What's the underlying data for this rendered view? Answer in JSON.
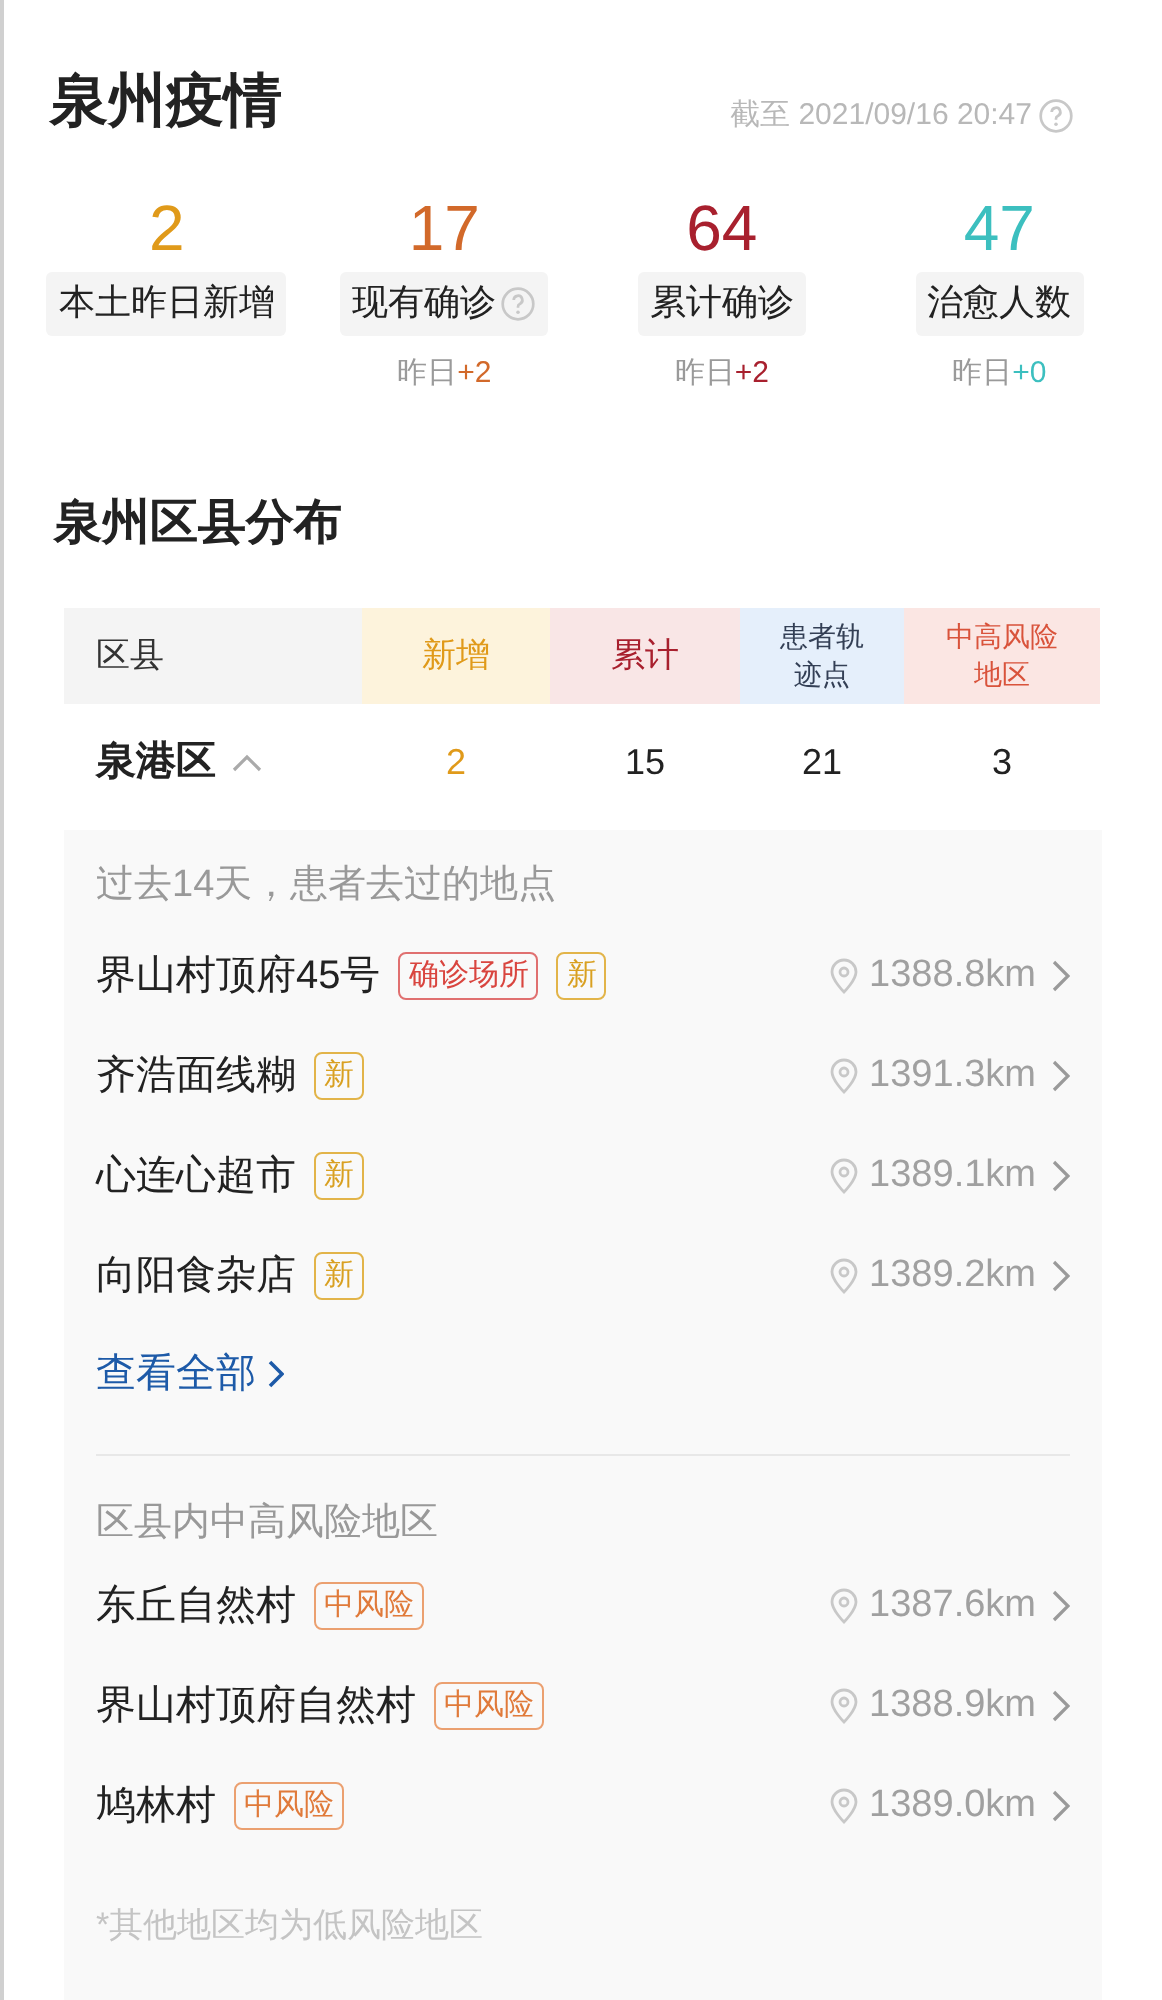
{
  "header": {
    "title": "泉州疫情",
    "timestamp": "截至 2021/09/16 20:47"
  },
  "stats": [
    {
      "value": "2",
      "label": "本土昨日新增",
      "color": "#e09a1a",
      "help": false
    },
    {
      "value": "17",
      "label": "现有确诊",
      "color": "#d2692a",
      "help": true,
      "delta_label": "昨日",
      "delta": "+2"
    },
    {
      "value": "64",
      "label": "累计确诊",
      "color": "#a8202e",
      "help": false,
      "delta_label": "昨日",
      "delta": "+2"
    },
    {
      "value": "47",
      "label": "治愈人数",
      "color": "#3cbfbf",
      "help": false,
      "delta_label": "昨日",
      "delta": "+0"
    }
  ],
  "district_section": {
    "title": "泉州区县分布"
  },
  "table": {
    "columns": [
      "区县",
      "新增",
      "累计",
      "患者轨迹点",
      "中高风险地区"
    ],
    "rows": [
      {
        "expanded": true,
        "cells": [
          "泉港区",
          "2",
          "15",
          "21",
          "3"
        ]
      }
    ]
  },
  "places": {
    "title": "过去14天，患者去过的地点",
    "items": [
      {
        "name": "界山村顶府45号",
        "tags": [
          {
            "kind": "confirmed",
            "text": "确诊场所"
          },
          {
            "kind": "new",
            "text": "新"
          }
        ],
        "distance": "1388.8km"
      },
      {
        "name": "齐浩面线糊",
        "tags": [
          {
            "kind": "new",
            "text": "新"
          }
        ],
        "distance": "1391.3km"
      },
      {
        "name": "心连心超市",
        "tags": [
          {
            "kind": "new",
            "text": "新"
          }
        ],
        "distance": "1389.1km"
      },
      {
        "name": "向阳食杂店",
        "tags": [
          {
            "kind": "new",
            "text": "新"
          }
        ],
        "distance": "1389.2km"
      }
    ],
    "view_all": "查看全部"
  },
  "risk_areas": {
    "title": "区县内中高风险地区",
    "items": [
      {
        "name": "东丘自然村",
        "tags": [
          {
            "kind": "mid-risk",
            "text": "中风险"
          }
        ],
        "distance": "1387.6km"
      },
      {
        "name": "界山村顶府自然村",
        "tags": [
          {
            "kind": "mid-risk",
            "text": "中风险"
          }
        ],
        "distance": "1388.9km"
      },
      {
        "name": "鸠林村",
        "tags": [
          {
            "kind": "mid-risk",
            "text": "中风险"
          }
        ],
        "distance": "1389.0km"
      }
    ],
    "footnote": "*其他地区均为低风险地区"
  }
}
